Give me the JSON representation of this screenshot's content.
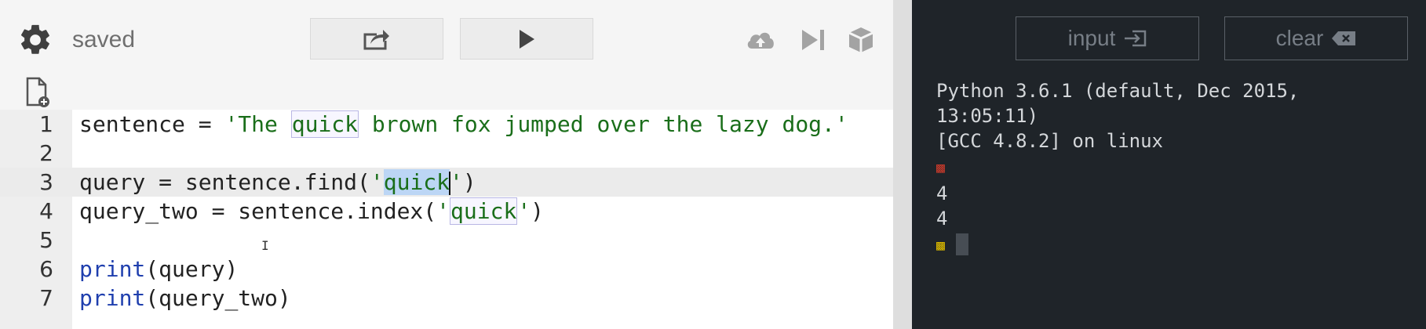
{
  "toolbar": {
    "status": "saved",
    "share_icon": "share-icon",
    "run_icon": "play-icon",
    "icons": [
      "cloud-upload-icon",
      "step-forward-icon",
      "package-icon"
    ]
  },
  "editor": {
    "lines": [
      {
        "num": "1"
      },
      {
        "num": "2"
      },
      {
        "num": "3"
      },
      {
        "num": "4"
      },
      {
        "num": "5"
      },
      {
        "num": "6"
      },
      {
        "num": "7"
      }
    ],
    "code": {
      "l1_a": "sentence = ",
      "l1_q": "'The ",
      "l1_hl": "quick",
      "l1_rest": " brown fox jumped over the lazy dog.'",
      "l3_a": "query = sentence.find(",
      "l3_q": "'",
      "l3_sel": "quick",
      "l3_end": "'",
      "l3_close": ")",
      "l4_a": "query_two = sentence.index(",
      "l4_q": "'",
      "l4_hl": "quick",
      "l4_end": "'",
      "l4_close": ")",
      "l6_kw": "print",
      "l6_rest": "(query)",
      "l7_kw": "print",
      "l7_rest": "(query_two)"
    }
  },
  "console": {
    "input_label": "input",
    "clear_label": "clear",
    "output": [
      "Python 3.6.1 (default, Dec 2015,",
      "13:05:11)",
      "[GCC 4.8.2] on linux"
    ],
    "results": [
      "4",
      "4"
    ]
  },
  "colors": {
    "console_bg": "#1f2429",
    "string": "#1a6e1a",
    "keyword": "#1f3fae"
  }
}
